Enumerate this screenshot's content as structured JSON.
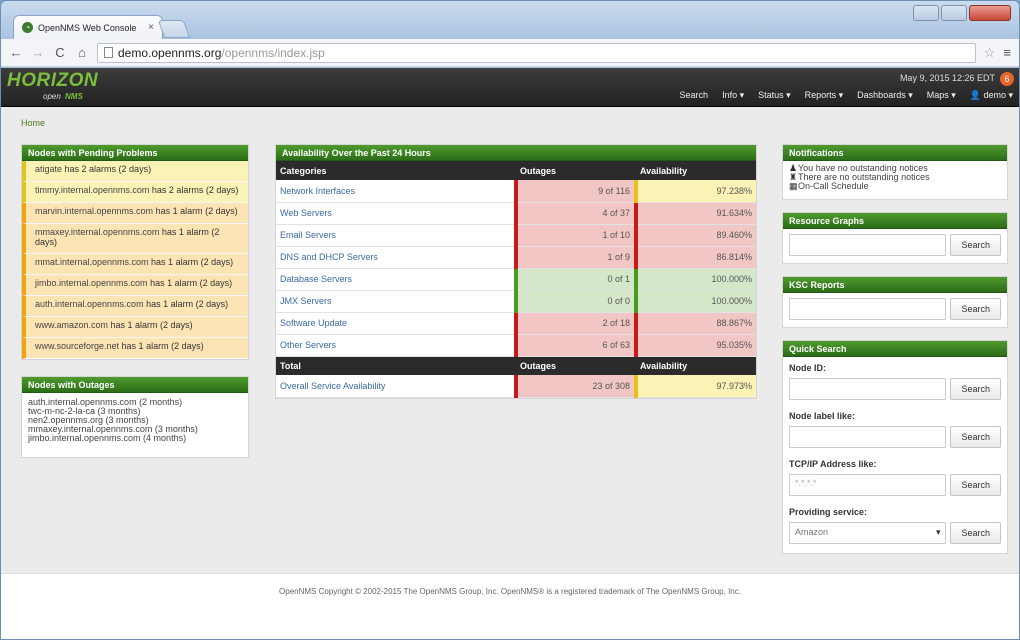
{
  "browser": {
    "tab_title": "OpenNMS Web Console",
    "tab_close": "×",
    "url_host": "demo.opennms.org",
    "url_path": "/opennms/index.jsp"
  },
  "navbar": {
    "logo_main": "HORIZON",
    "logo_open": "open",
    "logo_nms": "NMS",
    "datetime": "May 9, 2015 12:26 EDT",
    "alert_count": "6",
    "menu": [
      "Search",
      "Info ▾",
      "Status ▾",
      "Reports ▾",
      "Dashboards ▾",
      "Maps ▾",
      "👤 demo ▾"
    ]
  },
  "breadcrumb": "Home",
  "pending": {
    "title": "Nodes with Pending Problems",
    "rows": [
      {
        "node": "atigate",
        "text": " has 2 alarms (2 days)",
        "color": "yellow"
      },
      {
        "node": "timmy.internal.opennms.com",
        "text": " has 2 alarms (2 days)",
        "color": "orange"
      },
      {
        "node": "marvin.internal.opennms.com",
        "text": " has 1 alarm (2 days)",
        "color": "orange"
      },
      {
        "node": "mmaxey.internal.opennms.com",
        "text": " has 1 alarm (2 days)",
        "color": "orange"
      },
      {
        "node": "mmat.internal.opennms.com",
        "text": " has 1 alarm (2 days)",
        "color": "orange"
      },
      {
        "node": "jimbo.internal.opennms.com",
        "text": " has 1 alarm (2 days)",
        "color": "orange"
      },
      {
        "node": "auth.internal.opennms.com",
        "text": " has 1 alarm (2 days)",
        "color": "orange"
      },
      {
        "node": "www.amazon.com",
        "text": " has 1 alarm (2 days)",
        "color": "orange"
      },
      {
        "node": "www.sourceforge.net",
        "text": " has 1 alarm (2 days)",
        "color": "orange"
      }
    ]
  },
  "outages": {
    "title": "Nodes with Outages",
    "rows": [
      "auth.internal.opennms.com (2 months)",
      "twc-m-nc-2-la-ca (3 months)",
      "nen2.opennms.org (3 months)",
      "mmaxey.internal.opennms.com (3 months)",
      "jimbo.internal.opennms.com (4 months)"
    ]
  },
  "availability": {
    "title": "Availability Over the Past 24 Hours",
    "col_categories": "Categories",
    "col_outages": "Outages",
    "col_availability": "Availability",
    "rows": [
      {
        "category": "Network Interfaces",
        "outages": "9 of 116",
        "availability": "97.238%",
        "out_color": "red",
        "av_color": "yellow"
      },
      {
        "category": "Web Servers",
        "outages": "4 of 37",
        "availability": "91.634%",
        "out_color": "red",
        "av_color": "red"
      },
      {
        "category": "Email Servers",
        "outages": "1 of 10",
        "availability": "89.460%",
        "out_color": "red",
        "av_color": "red"
      },
      {
        "category": "DNS and DHCP Servers",
        "outages": "1 of 9",
        "availability": "86.814%",
        "out_color": "red",
        "av_color": "red"
      },
      {
        "category": "Database Servers",
        "outages": "0 of 1",
        "availability": "100.000%",
        "out_color": "green",
        "av_color": "green"
      },
      {
        "category": "JMX Servers",
        "outages": "0 of 0",
        "availability": "100.000%",
        "out_color": "green",
        "av_color": "green"
      },
      {
        "category": "Software Update",
        "outages": "2 of 18",
        "availability": "88.867%",
        "out_color": "red",
        "av_color": "red"
      },
      {
        "category": "Other Servers",
        "outages": "6 of 63",
        "availability": "95.035%",
        "out_color": "red",
        "av_color": "red"
      }
    ],
    "total_label": "Total",
    "total_row": {
      "category": "Overall Service Availability",
      "outages": "23 of 308",
      "availability": "97.973%"
    }
  },
  "notifications": {
    "title": "Notifications",
    "lines": [
      "You have no outstanding notices",
      "There are no outstanding notices",
      "On-Call Schedule"
    ]
  },
  "resource_graphs": {
    "title": "Resource Graphs",
    "button": "Search"
  },
  "ksc_reports": {
    "title": "KSC Reports",
    "button": "Search"
  },
  "quick_search": {
    "title": "Quick Search",
    "node_id_label": "Node ID:",
    "node_label_label": "Node label like:",
    "tcpip_label": "TCP/IP Address like:",
    "tcpip_placeholder": "*.*.*.*",
    "service_label": "Providing service:",
    "service_value": "Amazon",
    "button": "Search"
  },
  "footer": "OpenNMS Copyright © 2002-2015 The OpenNMS Group, Inc. OpenNMS® is a registered trademark of The OpenNMS Group, Inc."
}
